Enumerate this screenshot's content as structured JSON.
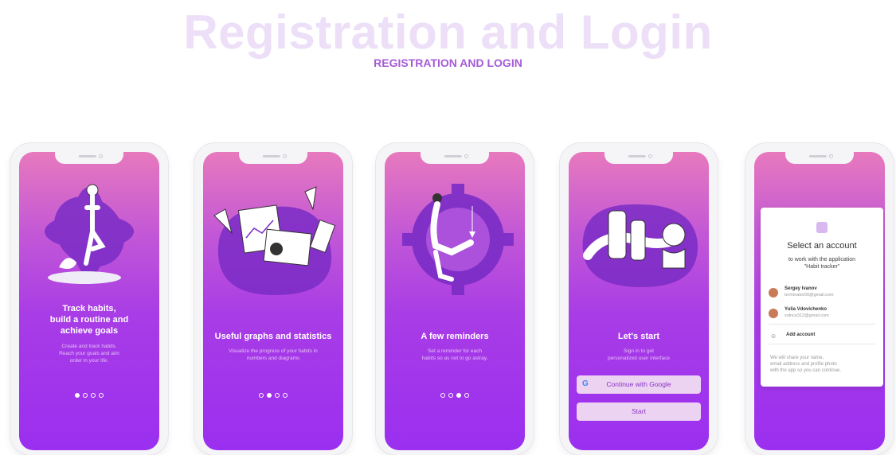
{
  "header": {
    "title": "Registration and Login",
    "subtitle": "REGISTRATION AND LOGIN"
  },
  "screens": [
    {
      "title_lines": [
        "Track habits,",
        "build a routine and",
        "achieve goals"
      ],
      "text_lines": [
        "Create and track habits.",
        "Reach your goals and aim",
        "order in your life."
      ],
      "active_dot": 0
    },
    {
      "title": "Useful graphs and statistics",
      "text_lines": [
        "Visualize the progress of your habits in",
        "numbers and diagrams"
      ],
      "active_dot": 1
    },
    {
      "title": "A few reminders",
      "text_lines": [
        "Set a reminder for each",
        "habits so as not to go astray."
      ],
      "active_dot": 2
    },
    {
      "title": "Let's start",
      "text_lines": [
        "Sign in to get",
        "personalized user interface"
      ],
      "google_button": "Continue with Google",
      "start_button": "Start"
    },
    {
      "sheet_title": "Select an account",
      "sheet_sub_lines": [
        "to work with the application",
        "\"Habit tracker\""
      ],
      "accounts": [
        {
          "name": "Sergey Ivanov",
          "email": "terminator00@gmail.com"
        },
        {
          "name": "Yulia Vdovichenko",
          "email": "solnce312@gmail.com"
        }
      ],
      "add_account": "Add account",
      "footer_lines": [
        "We will share your name,",
        "email address and profile photo",
        "with the app so you can continue."
      ]
    }
  ],
  "colors": {
    "accent": "#a55bd6",
    "gradient_top": "#e779bd",
    "gradient_bottom": "#9b2ff0",
    "button_bg": "#ecd3f2"
  }
}
